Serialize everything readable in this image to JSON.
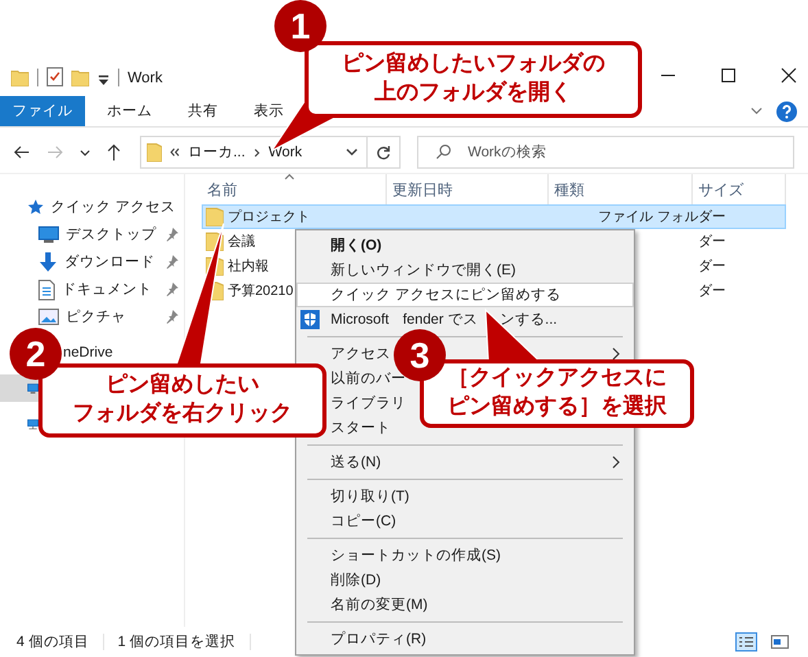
{
  "window": {
    "title": "Work"
  },
  "ribbon_tabs": [
    {
      "label": "ファイル",
      "kind": "file"
    },
    {
      "label": "ホーム",
      "kind": "tab"
    },
    {
      "label": "共有",
      "kind": "tab"
    },
    {
      "label": "表示",
      "kind": "tab"
    }
  ],
  "address": {
    "segments": [
      "ローカ...",
      "Work"
    ]
  },
  "search": {
    "placeholder": "Workの検索"
  },
  "nav": [
    {
      "label": "クイック アクセス",
      "kind": "star",
      "pinned": false,
      "selected": false
    },
    {
      "label": "デスクトップ",
      "kind": "desktop",
      "pinned": true,
      "selected": false
    },
    {
      "label": "ダウンロード",
      "kind": "download",
      "pinned": true,
      "selected": false
    },
    {
      "label": "ドキュメント",
      "kind": "document",
      "pinned": true,
      "selected": false
    },
    {
      "label": "ピクチャ",
      "kind": "picture",
      "pinned": true,
      "selected": false
    },
    {
      "label": "neDrive",
      "kind": "cloud",
      "pinned": false,
      "selected": false
    },
    {
      "kind": "pc",
      "selected": true
    },
    {
      "kind": "network",
      "selected": false
    }
  ],
  "columns": [
    "名前",
    "更新日時",
    "種類",
    "サイズ"
  ],
  "files": [
    {
      "name": "プロジェクト",
      "type": "ファイル フォルダー",
      "selected": true
    },
    {
      "name": "会議",
      "type": "ダー",
      "selected": false
    },
    {
      "name": "社内報",
      "type": "ダー",
      "selected": false
    },
    {
      "name": "予算20210",
      "type": "ダー",
      "selected": false
    }
  ],
  "context_menu": [
    {
      "kind": "item",
      "label": "開く(O)",
      "bold": true,
      "highlighted": false,
      "icon": false,
      "submenu": false
    },
    {
      "kind": "item",
      "label": "新しいウィンドウで開く(E)",
      "bold": false,
      "highlighted": false,
      "icon": false,
      "submenu": false
    },
    {
      "kind": "item",
      "label": "クイック アクセスにピン留めする",
      "bold": false,
      "highlighted": true,
      "icon": false,
      "submenu": false
    },
    {
      "kind": "item",
      "label": "Microsoft",
      "bold": false,
      "highlighted": false,
      "icon": true,
      "submenu": false
    },
    {
      "kind": "separator"
    },
    {
      "kind": "item",
      "label": "アクセス",
      "bold": false,
      "highlighted": false,
      "icon": false,
      "submenu": true
    },
    {
      "kind": "item",
      "label": "以前のバー",
      "bold": false,
      "highlighted": false,
      "icon": false,
      "submenu": false
    },
    {
      "kind": "item",
      "label": "ライブラリ",
      "bold": false,
      "highlighted": false,
      "icon": false,
      "submenu": false
    },
    {
      "kind": "item",
      "label": "スタート",
      "bold": false,
      "highlighted": false,
      "icon": false,
      "submenu": false
    },
    {
      "kind": "separator"
    },
    {
      "kind": "item",
      "label": "送る(N)",
      "bold": false,
      "highlighted": false,
      "icon": false,
      "submenu": true
    },
    {
      "kind": "separator"
    },
    {
      "kind": "item",
      "label": "切り取り(T)",
      "bold": false,
      "highlighted": false,
      "icon": false,
      "submenu": false
    },
    {
      "kind": "item",
      "label": "コピー(C)",
      "bold": false,
      "highlighted": false,
      "icon": false,
      "submenu": false
    },
    {
      "kind": "separator"
    },
    {
      "kind": "item",
      "label": "ショートカットの作成(S)",
      "bold": false,
      "highlighted": false,
      "icon": false,
      "submenu": false
    },
    {
      "kind": "item",
      "label": "削除(D)",
      "bold": false,
      "highlighted": false,
      "icon": false,
      "submenu": false
    },
    {
      "kind": "item",
      "label": "名前の変更(M)",
      "bold": false,
      "highlighted": false,
      "icon": false,
      "submenu": false
    },
    {
      "kind": "separator"
    },
    {
      "kind": "item",
      "label": "プロパティ(R)",
      "bold": false,
      "highlighted": false,
      "icon": false,
      "submenu": false
    }
  ],
  "menu_fragments": [
    "fender でス",
    "ンする..."
  ],
  "status_bar": {
    "count": "4 個の項目",
    "selection": "1 個の項目を選択"
  },
  "callouts": [
    {
      "number": "1",
      "lines": [
        "ピン留めしたいフォルダの",
        "上のフォルダを開く"
      ]
    },
    {
      "number": "2",
      "lines": [
        "ピン留めしたい",
        "フォルダを右クリック"
      ]
    },
    {
      "number": "3",
      "lines": [
        "［クイックアクセスに",
        "ピン留めする］を選択"
      ]
    }
  ]
}
